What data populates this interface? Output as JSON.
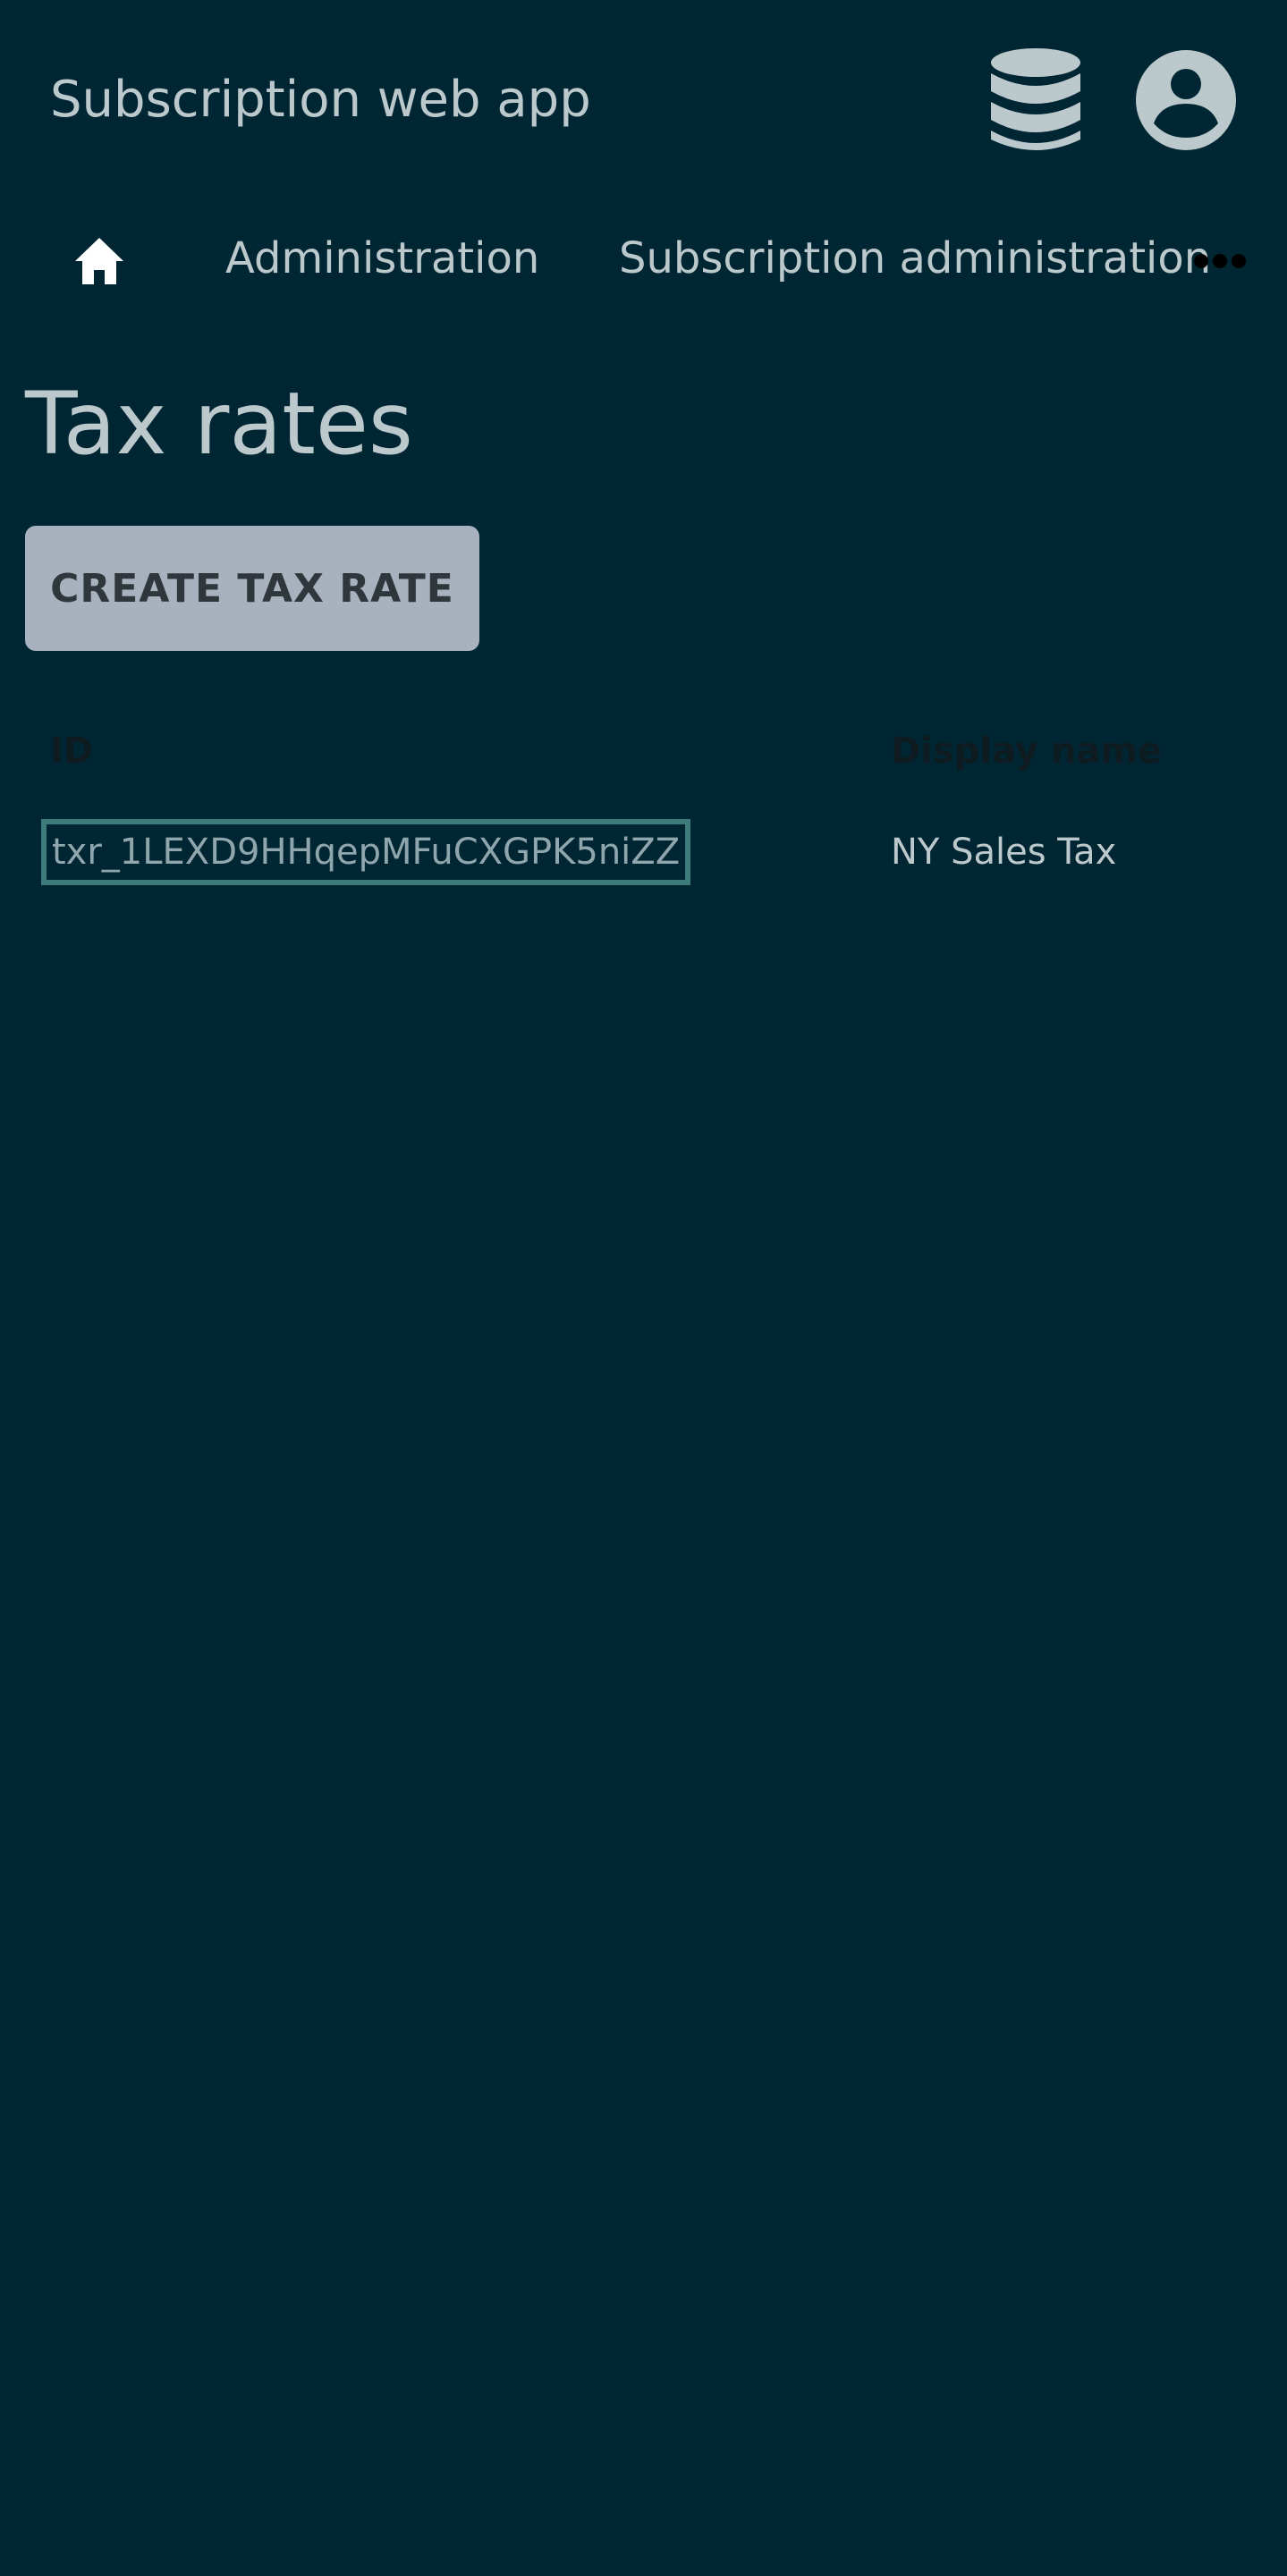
{
  "header": {
    "app_title": "Subscription web app",
    "icons": [
      "database-icon",
      "account-circle-icon"
    ]
  },
  "breadcrumb": {
    "home_icon": "home-icon",
    "items": [
      {
        "label": "Administration"
      },
      {
        "label": "Subscription administration"
      }
    ],
    "more_icon": "more-horizontal-icon"
  },
  "page": {
    "title": "Tax rates",
    "create_button_label": "CREATE TAX RATE"
  },
  "table": {
    "columns": [
      "ID",
      "Display name"
    ],
    "rows": [
      {
        "id": "txr_1LEXD9HHqepMFuCXGPK5niZZ",
        "display_name": "NY Sales Tax"
      }
    ]
  },
  "colors": {
    "background": "#002633",
    "text": "#bcc9cc",
    "button_bg": "#a8b2bf",
    "button_text": "#2f363c",
    "focus_outline": "#3d7a7a",
    "header_text": "#0e1c22"
  }
}
